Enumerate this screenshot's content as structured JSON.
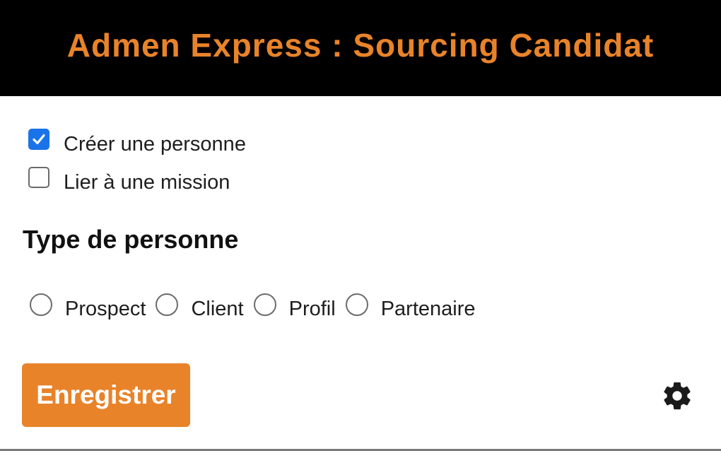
{
  "header": {
    "title": "Admen Express : Sourcing Candidat",
    "background": "#000000",
    "title_color": "#e8832a"
  },
  "options": {
    "create_person": {
      "label": "Créer une personne",
      "checked": true
    },
    "link_mission": {
      "label": "Lier à une mission",
      "checked": false
    }
  },
  "person_type": {
    "title": "Type de personne",
    "choices": [
      {
        "label": "Prospect",
        "selected": false
      },
      {
        "label": "Client",
        "selected": false
      },
      {
        "label": "Profil",
        "selected": false
      },
      {
        "label": "Partenaire",
        "selected": false
      }
    ]
  },
  "actions": {
    "save_label": "Enregistrer",
    "save_color": "#e8832a",
    "settings_icon": "gear-icon"
  },
  "colors": {
    "checkbox_checked": "#1a73e8"
  }
}
